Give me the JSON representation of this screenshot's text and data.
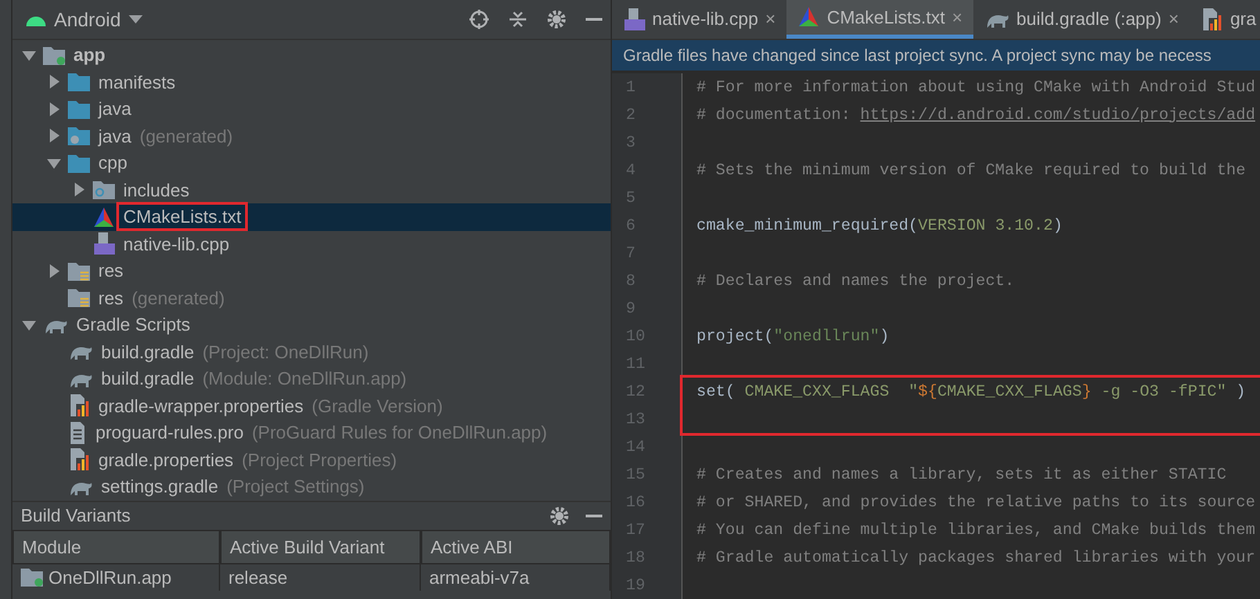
{
  "project_panel": {
    "view": "Android",
    "tree": [
      {
        "label": "app",
        "kind": "module",
        "expanded": true,
        "selected": false,
        "children": [
          {
            "label": "manifests",
            "kind": "folder",
            "expanded": false,
            "selected": false
          },
          {
            "label": "java",
            "kind": "folder",
            "expanded": false,
            "selected": false
          },
          {
            "label": "java",
            "note": "(generated)",
            "kind": "folder-gen",
            "expanded": false,
            "selected": false
          },
          {
            "label": "cpp",
            "kind": "folder",
            "expanded": true,
            "selected": false,
            "children": [
              {
                "label": "includes",
                "kind": "folder-inc",
                "expanded": false,
                "selected": false
              },
              {
                "label": "CMakeLists.txt",
                "kind": "cmake",
                "selected": true,
                "highlighted": true
              },
              {
                "label": "native-lib.cpp",
                "kind": "cpp",
                "selected": false
              }
            ]
          },
          {
            "label": "res",
            "kind": "folder-res",
            "expanded": false,
            "selected": false
          },
          {
            "label": "res",
            "note": "(generated)",
            "kind": "folder-res",
            "selected": false
          }
        ]
      },
      {
        "label": "Gradle Scripts",
        "kind": "gradle",
        "expanded": true,
        "selected": false,
        "children": [
          {
            "label": "build.gradle",
            "note": "(Project: OneDllRun)",
            "kind": "gradle",
            "selected": false
          },
          {
            "label": "build.gradle",
            "note": "(Module: OneDllRun.app)",
            "kind": "gradle",
            "selected": false
          },
          {
            "label": "gradle-wrapper.properties",
            "note": "(Gradle Version)",
            "kind": "properties",
            "selected": false
          },
          {
            "label": "proguard-rules.pro",
            "note": "(ProGuard Rules for OneDllRun.app)",
            "kind": "file",
            "selected": false
          },
          {
            "label": "gradle.properties",
            "note": "(Project Properties)",
            "kind": "properties",
            "selected": false
          },
          {
            "label": "settings.gradle",
            "note": "(Project Settings)",
            "kind": "gradle",
            "selected": false
          }
        ]
      }
    ]
  },
  "build_variants": {
    "title": "Build Variants",
    "columns": [
      "Module",
      "Active Build Variant",
      "Active ABI"
    ],
    "rows": [
      [
        "OneDllRun.app",
        "release",
        "armeabi-v7a"
      ]
    ]
  },
  "editor": {
    "tabs": [
      {
        "label": "native-lib.cpp",
        "kind": "cpp",
        "selected": false,
        "closable": true
      },
      {
        "label": "CMakeLists.txt",
        "kind": "cmake",
        "selected": true,
        "closable": true
      },
      {
        "label": "build.gradle (:app)",
        "kind": "gradle",
        "selected": false,
        "closable": true
      },
      {
        "label": "gra",
        "kind": "properties",
        "selected": false
      }
    ],
    "close_glyph": "×",
    "banner": "Gradle files have changed since last project sync. A project sync may be necess",
    "lines": [
      {
        "number": "1",
        "segments": [
          {
            "kind": "comment",
            "text": "# For more information about using CMake with Android Stud"
          }
        ]
      },
      {
        "number": "2",
        "segments": [
          {
            "kind": "comment",
            "text": "# documentation: "
          },
          {
            "kind": "link",
            "text": "https://d.android.com/studio/projects/add"
          }
        ]
      },
      {
        "number": "3"
      },
      {
        "number": "4",
        "segments": [
          {
            "kind": "comment",
            "text": "# Sets the minimum version of CMake required to build the"
          }
        ]
      },
      {
        "number": "5"
      },
      {
        "number": "6",
        "segments": [
          {
            "kind": "plain",
            "text": "cmake_minimum_required("
          },
          {
            "kind": "arg",
            "text": "VERSION 3.10.2"
          },
          {
            "kind": "plain",
            "text": ")"
          }
        ]
      },
      {
        "number": "7"
      },
      {
        "number": "8",
        "segments": [
          {
            "kind": "comment",
            "text": "# Declares and names the project."
          }
        ]
      },
      {
        "number": "9"
      },
      {
        "number": "10",
        "segments": [
          {
            "kind": "plain",
            "text": "project("
          },
          {
            "kind": "string",
            "text": "\"onedllrun\""
          },
          {
            "kind": "plain",
            "text": ")"
          }
        ]
      },
      {
        "number": "11"
      },
      {
        "number": "12",
        "highlighted": true,
        "segments": [
          {
            "kind": "plain",
            "text": "set( "
          },
          {
            "kind": "arg",
            "text": "CMAKE_CXX_FLAGS  \""
          },
          {
            "kind": "var",
            "text": "${"
          },
          {
            "kind": "arg",
            "text": "CMAKE_CXX_FLAGS"
          },
          {
            "kind": "var",
            "text": "}"
          },
          {
            "kind": "arg",
            "text": " -g -O3 -fPIC\""
          },
          {
            "kind": "plain",
            "text": " )"
          }
        ]
      },
      {
        "number": "13"
      },
      {
        "number": "14"
      },
      {
        "number": "15",
        "segments": [
          {
            "kind": "comment",
            "text": "# Creates and names a library, sets it as either STATIC"
          }
        ]
      },
      {
        "number": "16",
        "segments": [
          {
            "kind": "comment",
            "text": "# or SHARED, and provides the relative paths to its source"
          }
        ]
      },
      {
        "number": "17",
        "segments": [
          {
            "kind": "comment",
            "text": "# You can define multiple libraries, and CMake builds them"
          }
        ]
      },
      {
        "number": "18",
        "segments": [
          {
            "kind": "comment",
            "text": "# Gradle automatically packages shared libraries with your"
          }
        ]
      },
      {
        "number": "19"
      }
    ]
  }
}
